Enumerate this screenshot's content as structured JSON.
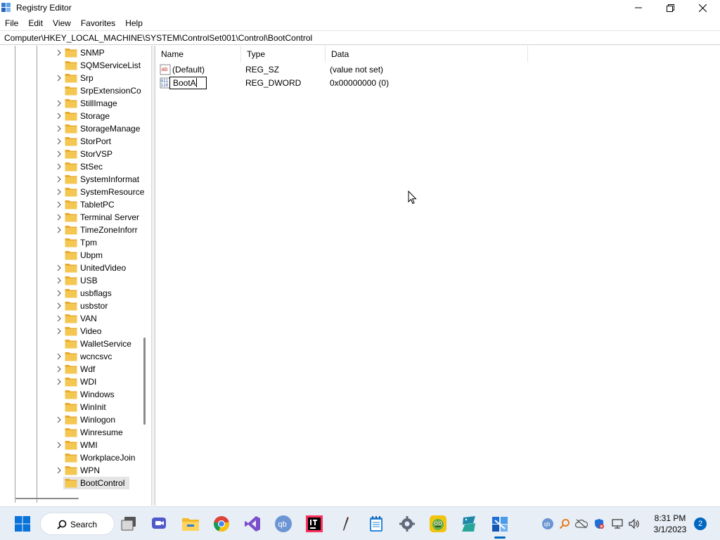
{
  "window": {
    "title": "Registry Editor",
    "minimize_icon": "minimize-icon",
    "maximize_icon": "restore-icon",
    "close_icon": "close-icon"
  },
  "menu": [
    "File",
    "Edit",
    "View",
    "Favorites",
    "Help"
  ],
  "address": "Computer\\HKEY_LOCAL_MACHINE\\SYSTEM\\ControlSet001\\Control\\BootControl",
  "tree": {
    "items": [
      {
        "label": "SNMP",
        "expandable": true
      },
      {
        "label": "SQMServiceList",
        "expandable": false
      },
      {
        "label": "Srp",
        "expandable": true
      },
      {
        "label": "SrpExtensionCo",
        "expandable": false
      },
      {
        "label": "StillImage",
        "expandable": true
      },
      {
        "label": "Storage",
        "expandable": true
      },
      {
        "label": "StorageManage",
        "expandable": true
      },
      {
        "label": "StorPort",
        "expandable": true
      },
      {
        "label": "StorVSP",
        "expandable": true
      },
      {
        "label": "StSec",
        "expandable": true
      },
      {
        "label": "SystemInformat",
        "expandable": true
      },
      {
        "label": "SystemResource",
        "expandable": true
      },
      {
        "label": "TabletPC",
        "expandable": true
      },
      {
        "label": "Terminal Server",
        "expandable": true
      },
      {
        "label": "TimeZoneInforr",
        "expandable": true
      },
      {
        "label": "Tpm",
        "expandable": false
      },
      {
        "label": "Ubpm",
        "expandable": false
      },
      {
        "label": "UnitedVideo",
        "expandable": true
      },
      {
        "label": "USB",
        "expandable": true
      },
      {
        "label": "usbflags",
        "expandable": true
      },
      {
        "label": "usbstor",
        "expandable": true
      },
      {
        "label": "VAN",
        "expandable": true
      },
      {
        "label": "Video",
        "expandable": true
      },
      {
        "label": "WalletService",
        "expandable": false
      },
      {
        "label": "wcncsvc",
        "expandable": true
      },
      {
        "label": "Wdf",
        "expandable": true
      },
      {
        "label": "WDI",
        "expandable": true
      },
      {
        "label": "Windows",
        "expandable": false
      },
      {
        "label": "WinInit",
        "expandable": false
      },
      {
        "label": "Winlogon",
        "expandable": true
      },
      {
        "label": "Winresume",
        "expandable": false
      },
      {
        "label": "WMI",
        "expandable": true
      },
      {
        "label": "WorkplaceJoin",
        "expandable": false
      },
      {
        "label": "WPN",
        "expandable": true
      },
      {
        "label": "BootControl",
        "expandable": false,
        "selected": true
      }
    ]
  },
  "list": {
    "columns": [
      "Name",
      "Type",
      "Data"
    ],
    "rows": [
      {
        "icon": "string-value-icon",
        "name": "(Default)",
        "type": "REG_SZ",
        "data": "(value not set)",
        "editing": false
      },
      {
        "icon": "dword-value-icon",
        "name": "BootA",
        "type": "REG_DWORD",
        "data": "0x00000000 (0)",
        "editing": true
      }
    ]
  },
  "taskbar": {
    "search_label": "Search",
    "apps": [
      "start-icon",
      "task-view-icon",
      "teams-chat-icon",
      "file-explorer-icon",
      "chrome-icon",
      "visual-studio-icon",
      "qbittorrent-icon",
      "intellij-icon",
      "pen-icon",
      "notepad-icon",
      "settings-icon",
      "bluestacks-icon",
      "python-idle-icon",
      "regedit-icon"
    ],
    "tray": [
      "qbittorrent-tray-icon",
      "search-tray-icon",
      "onedrive-icon",
      "security-icon",
      "network-icon",
      "volume-icon"
    ],
    "time": "8:31 PM",
    "date": "3/1/2023",
    "notifications": "2"
  },
  "colors": {
    "folder": "#f4c752",
    "taskbar_bg": "#e8eef6",
    "accent": "#0067c0",
    "selection": "#e5e5e5"
  }
}
